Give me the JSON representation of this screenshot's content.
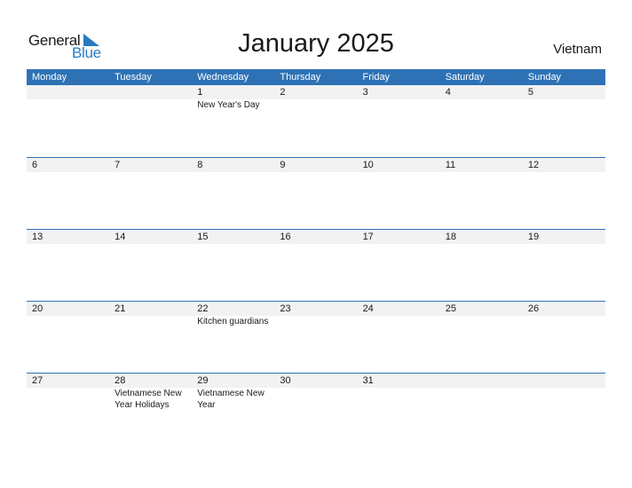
{
  "logo": {
    "part1": "General",
    "part2": "Blue",
    "accent_color": "#2a7ac0"
  },
  "title": "January 2025",
  "country": "Vietnam",
  "header_color": "#2e72b5",
  "weekdays": [
    "Monday",
    "Tuesday",
    "Wednesday",
    "Thursday",
    "Friday",
    "Saturday",
    "Sunday"
  ],
  "weeks": [
    {
      "days": [
        {
          "num": "",
          "holiday": ""
        },
        {
          "num": "",
          "holiday": ""
        },
        {
          "num": "1",
          "holiday": "New Year's Day"
        },
        {
          "num": "2",
          "holiday": ""
        },
        {
          "num": "3",
          "holiday": ""
        },
        {
          "num": "4",
          "holiday": ""
        },
        {
          "num": "5",
          "holiday": ""
        }
      ]
    },
    {
      "days": [
        {
          "num": "6",
          "holiday": ""
        },
        {
          "num": "7",
          "holiday": ""
        },
        {
          "num": "8",
          "holiday": ""
        },
        {
          "num": "9",
          "holiday": ""
        },
        {
          "num": "10",
          "holiday": ""
        },
        {
          "num": "11",
          "holiday": ""
        },
        {
          "num": "12",
          "holiday": ""
        }
      ]
    },
    {
      "days": [
        {
          "num": "13",
          "holiday": ""
        },
        {
          "num": "14",
          "holiday": ""
        },
        {
          "num": "15",
          "holiday": ""
        },
        {
          "num": "16",
          "holiday": ""
        },
        {
          "num": "17",
          "holiday": ""
        },
        {
          "num": "18",
          "holiday": ""
        },
        {
          "num": "19",
          "holiday": ""
        }
      ]
    },
    {
      "days": [
        {
          "num": "20",
          "holiday": ""
        },
        {
          "num": "21",
          "holiday": ""
        },
        {
          "num": "22",
          "holiday": "Kitchen guardians"
        },
        {
          "num": "23",
          "holiday": ""
        },
        {
          "num": "24",
          "holiday": ""
        },
        {
          "num": "25",
          "holiday": ""
        },
        {
          "num": "26",
          "holiday": ""
        }
      ]
    },
    {
      "days": [
        {
          "num": "27",
          "holiday": ""
        },
        {
          "num": "28",
          "holiday": "Vietnamese New Year Holidays"
        },
        {
          "num": "29",
          "holiday": "Vietnamese New Year"
        },
        {
          "num": "30",
          "holiday": ""
        },
        {
          "num": "31",
          "holiday": ""
        },
        {
          "num": "",
          "holiday": ""
        },
        {
          "num": "",
          "holiday": ""
        }
      ]
    }
  ]
}
